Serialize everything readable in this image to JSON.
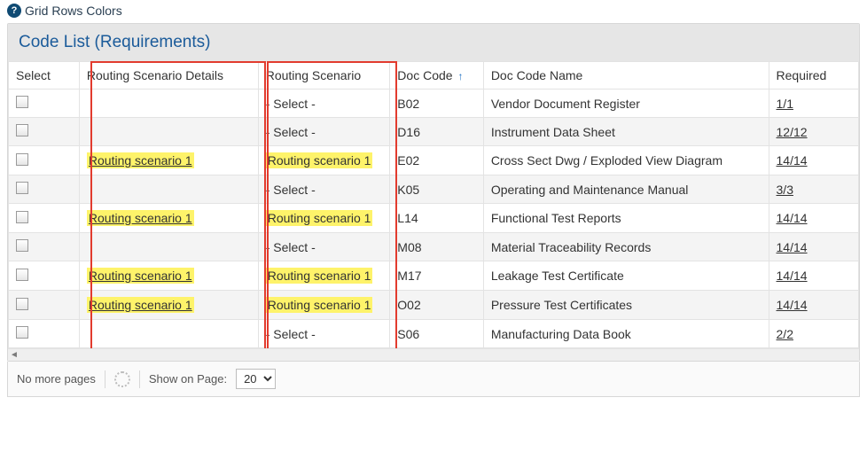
{
  "topLink": "Grid Rows Colors",
  "panelTitle": "Code List (Requirements)",
  "columns": {
    "select": "Select",
    "details": "Routing Scenario Details",
    "scenario": "Routing Scenario",
    "docCode": "Doc Code",
    "docName": "Doc Code Name",
    "required": "Required"
  },
  "selectPlaceholder": "- Select -",
  "scenarioValue": "Routing scenario 1",
  "rows": [
    {
      "details": "",
      "scenario": "",
      "docCode": "B02",
      "docName": "Vendor Document Register",
      "required": "1/1"
    },
    {
      "details": "",
      "scenario": "",
      "docCode": "D16",
      "docName": "Instrument Data Sheet",
      "required": "12/12"
    },
    {
      "details": "1",
      "scenario": "1",
      "docCode": "E02",
      "docName": "Cross Sect Dwg / Exploded View Diagram",
      "required": "14/14"
    },
    {
      "details": "",
      "scenario": "",
      "docCode": "K05",
      "docName": "Operating and Maintenance Manual",
      "required": "3/3"
    },
    {
      "details": "1",
      "scenario": "1",
      "docCode": "L14",
      "docName": "Functional Test Reports",
      "required": "14/14"
    },
    {
      "details": "",
      "scenario": "",
      "docCode": "M08",
      "docName": "Material Traceability Records",
      "required": "14/14"
    },
    {
      "details": "1",
      "scenario": "1",
      "docCode": "M17",
      "docName": "Leakage Test Certificate",
      "required": "14/14"
    },
    {
      "details": "1",
      "scenario": "1",
      "docCode": "O02",
      "docName": "Pressure Test Certificates",
      "required": "14/14"
    },
    {
      "details": "",
      "scenario": "",
      "docCode": "S06",
      "docName": "Manufacturing Data Book",
      "required": "2/2"
    }
  ],
  "footer": {
    "noMorePages": "No more pages",
    "showOnPage": "Show on Page:",
    "pageSize": "20"
  }
}
